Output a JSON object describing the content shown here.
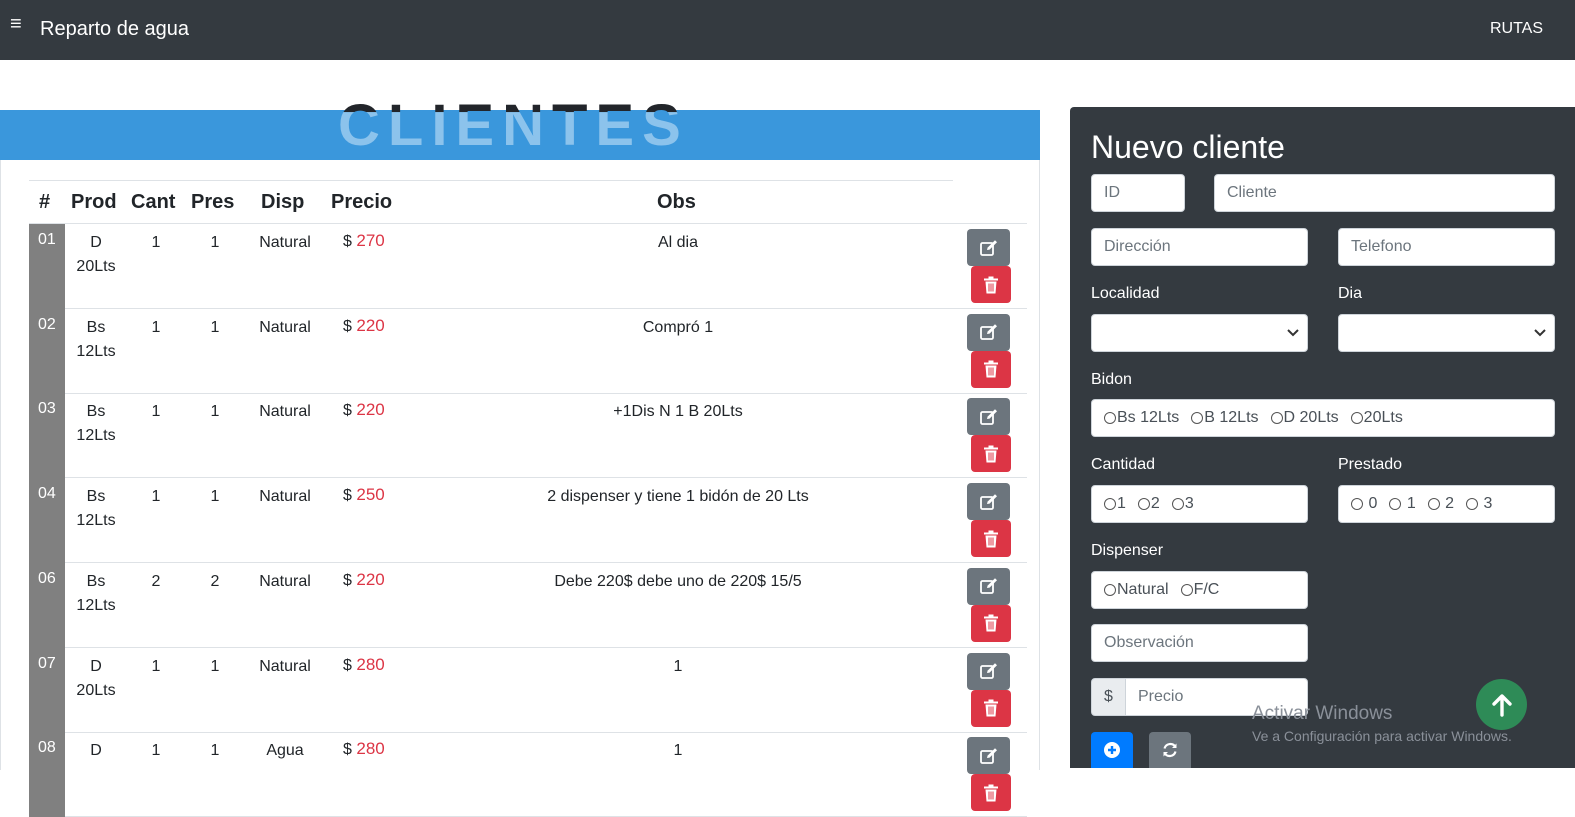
{
  "navbar": {
    "menu_icon": "hamburger-icon",
    "brand": "Reparto de agua",
    "link": "RUTAS"
  },
  "banner": {
    "title": "CLIENTES"
  },
  "table": {
    "headers": [
      "#",
      "Prod",
      "Cant",
      "Pres",
      "Disp",
      "Precio",
      "Obs"
    ],
    "currency": "$",
    "rows": [
      {
        "id": "01",
        "prod1": "D",
        "prod2": "20Lts",
        "cant": "1",
        "pres": "1",
        "disp": "Natural",
        "precio": "270",
        "obs": "Al dia"
      },
      {
        "id": "02",
        "prod1": "Bs",
        "prod2": "12Lts",
        "cant": "1",
        "pres": "1",
        "disp": "Natural",
        "precio": "220",
        "obs": "Compró 1"
      },
      {
        "id": "03",
        "prod1": "Bs",
        "prod2": "12Lts",
        "cant": "1",
        "pres": "1",
        "disp": "Natural",
        "precio": "220",
        "obs": "+1Dis N 1 B 20Lts"
      },
      {
        "id": "04",
        "prod1": "Bs",
        "prod2": "12Lts",
        "cant": "1",
        "pres": "1",
        "disp": "Natural",
        "precio": "250",
        "obs": "2 dispenser y tiene 1 bidón de 20 Lts"
      },
      {
        "id": "06",
        "prod1": "Bs",
        "prod2": "12Lts",
        "cant": "2",
        "pres": "2",
        "disp": "Natural",
        "precio": "220",
        "obs": "Debe 220$ debe uno de 220$ 15/5"
      },
      {
        "id": "07",
        "prod1": "D",
        "prod2": "20Lts",
        "cant": "1",
        "pres": "1",
        "disp": "Natural",
        "precio": "280",
        "obs": "1"
      },
      {
        "id": "08",
        "prod1": "D",
        "prod2": "",
        "cant": "1",
        "pres": "1",
        "disp": "Agua",
        "precio": "280",
        "obs": "1"
      }
    ]
  },
  "form": {
    "title": "Nuevo cliente",
    "id_placeholder": "ID",
    "cliente_placeholder": "Cliente",
    "direccion_placeholder": "Dirección",
    "telefono_placeholder": "Telefono",
    "localidad_label": "Localidad",
    "dia_label": "Dia",
    "bidon_label": "Bidon",
    "bidon_options": [
      "Bs 12Lts",
      "B 12Lts",
      "D 20Lts",
      "20Lts"
    ],
    "cantidad_label": "Cantidad",
    "cantidad_options": [
      "1",
      "2",
      "3"
    ],
    "prestado_label": "Prestado",
    "prestado_options": [
      "0",
      "1",
      "2",
      "3"
    ],
    "dispenser_label": "Dispenser",
    "dispenser_options": [
      "Natural",
      "F/C"
    ],
    "observacion_placeholder": "Observación",
    "precio_addon": "$",
    "precio_placeholder": "Precio"
  },
  "watermark": {
    "line1": "Activar Windows",
    "line2": "Ve a Configuración para activar Windows."
  },
  "colors": {
    "navbar": "#343a40",
    "banner": "#3a97dc",
    "danger": "#dc3545",
    "primary": "#007bff",
    "secondary": "#6c757d",
    "index_cell": "#808080",
    "scroll_top": "#2e8b57"
  }
}
